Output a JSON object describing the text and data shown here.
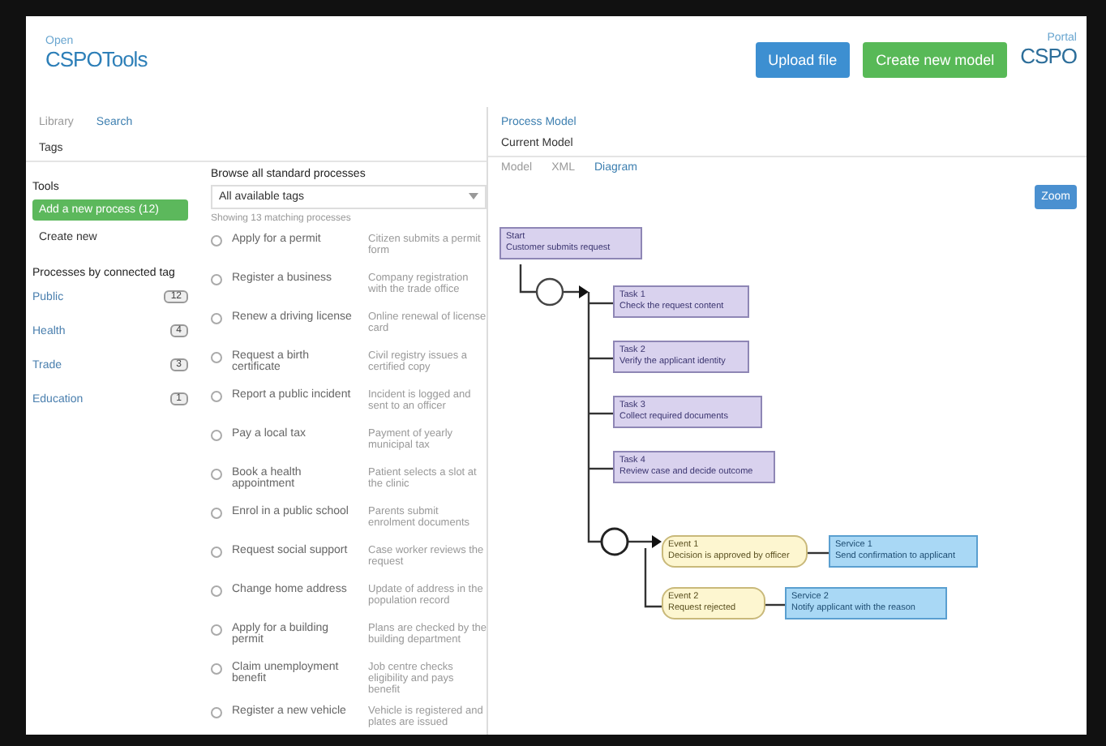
{
  "header": {
    "logo_small": "Open",
    "logo_main": "CSPOTools",
    "buttons": [
      {
        "label": "Upload file",
        "kind": "primary"
      },
      {
        "label": "Create new model",
        "kind": "success"
      }
    ],
    "right_logo_small": "Portal",
    "right_logo_main": "CSPO"
  },
  "nav_tabs": [
    {
      "label": "Library",
      "selected": false
    },
    {
      "label": "Search",
      "selected": true
    }
  ],
  "filter_label": "Tags",
  "sidebar": {
    "title": "Tools",
    "items": [
      {
        "label": "Add a new process (12)",
        "selected": true
      },
      {
        "label": "Create new",
        "selected": false
      }
    ],
    "section": "Processes by connected tag",
    "tags": [
      {
        "label": "Public",
        "count": "12"
      },
      {
        "label": "Health",
        "count": "4"
      },
      {
        "label": "Trade",
        "count": "3"
      },
      {
        "label": "Education",
        "count": "1"
      }
    ]
  },
  "list": {
    "title": "Browse all standard processes",
    "dropdown": "All available tags",
    "subtitle": "Showing 13 matching processes",
    "rows": [
      {
        "name": "Apply for a permit",
        "desc": "Citizen submits a permit form",
        "selected": false
      },
      {
        "name": "Register a business",
        "desc": "Company registration with the trade office",
        "selected": false
      },
      {
        "name": "Renew a driving license",
        "desc": "Online renewal of license card",
        "selected": false
      },
      {
        "name": "Request a birth certificate",
        "desc": "Civil registry issues a certified copy",
        "selected": false
      },
      {
        "name": "Report a public incident",
        "desc": "Incident is logged and sent to an officer",
        "selected": false
      },
      {
        "name": "Pay a local tax",
        "desc": "Payment of yearly municipal tax",
        "selected": false
      },
      {
        "name": "Book a health appointment",
        "desc": "Patient selects a slot at the clinic",
        "selected": false
      },
      {
        "name": "Enrol in a public school",
        "desc": "Parents submit enrolment documents",
        "selected": false
      },
      {
        "name": "Request social support",
        "desc": "Case worker reviews the request",
        "selected": false
      },
      {
        "name": "Change home address",
        "desc": "Update of address in the population record",
        "selected": false
      },
      {
        "name": "Apply for a building permit",
        "desc": "Plans are checked by the building department",
        "selected": false
      },
      {
        "name": "Claim unemployment benefit",
        "desc": "Job centre checks eligibility and pays benefit",
        "selected": false
      },
      {
        "name": "Register a new vehicle",
        "desc": "Vehicle is registered and plates are issued",
        "selected": false
      }
    ]
  },
  "model": {
    "title": "Process Model",
    "subtitle": "Current Model",
    "tabs": [
      {
        "label": "Model",
        "selected": false
      },
      {
        "label": "XML",
        "selected": false
      },
      {
        "label": "Diagram",
        "selected": true
      }
    ],
    "zoom_button": "Zoom",
    "nodes": [
      {
        "kind": "task",
        "id_label": "Start",
        "text": "Customer submits request"
      },
      {
        "kind": "task",
        "id_label": "Task 1",
        "text": "Check the request content"
      },
      {
        "kind": "task",
        "id_label": "Task 2",
        "text": "Verify the applicant identity"
      },
      {
        "kind": "task",
        "id_label": "Task 3",
        "text": "Collect required documents"
      },
      {
        "kind": "task",
        "id_label": "Task 4",
        "text": "Review case and decide outcome"
      },
      {
        "kind": "event",
        "id_label": "Event 1",
        "text": "Decision is approved by officer"
      },
      {
        "kind": "service",
        "id_label": "Service 1",
        "text": "Send confirmation to applicant"
      },
      {
        "kind": "event",
        "id_label": "Event 2",
        "text": "Request rejected"
      },
      {
        "kind": "service",
        "id_label": "Service 2",
        "text": "Notify applicant with the reason"
      }
    ]
  }
}
